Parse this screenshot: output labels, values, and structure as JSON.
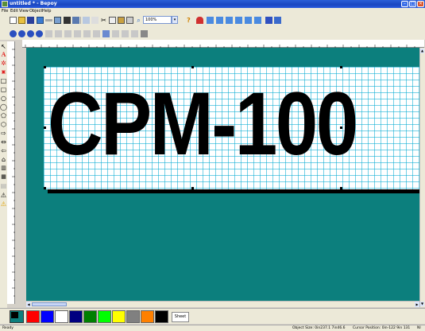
{
  "window": {
    "title": "untitled * - Bepoy"
  },
  "menubar": {
    "items": [
      "File",
      "Edit",
      "View",
      "Object",
      "Help"
    ]
  },
  "toolbar": {
    "zoom_value": "100%"
  },
  "canvas": {
    "text": "CPM-100",
    "background": "#0c7f7d"
  },
  "palette": {
    "colors": [
      "#000000",
      "#ff0000",
      "#0000ff",
      "#ffffff",
      "#000080",
      "#008000",
      "#00ff00",
      "#ffff00",
      "#808080",
      "#ff8000"
    ],
    "sheet_label": "Sheet"
  },
  "status": {
    "left": "Ready",
    "object_size": "Object Size: 0in237.1 7in46.6",
    "cursor_position": "Cursor Position: 0in-122 9in 131",
    "right": "NI"
  }
}
